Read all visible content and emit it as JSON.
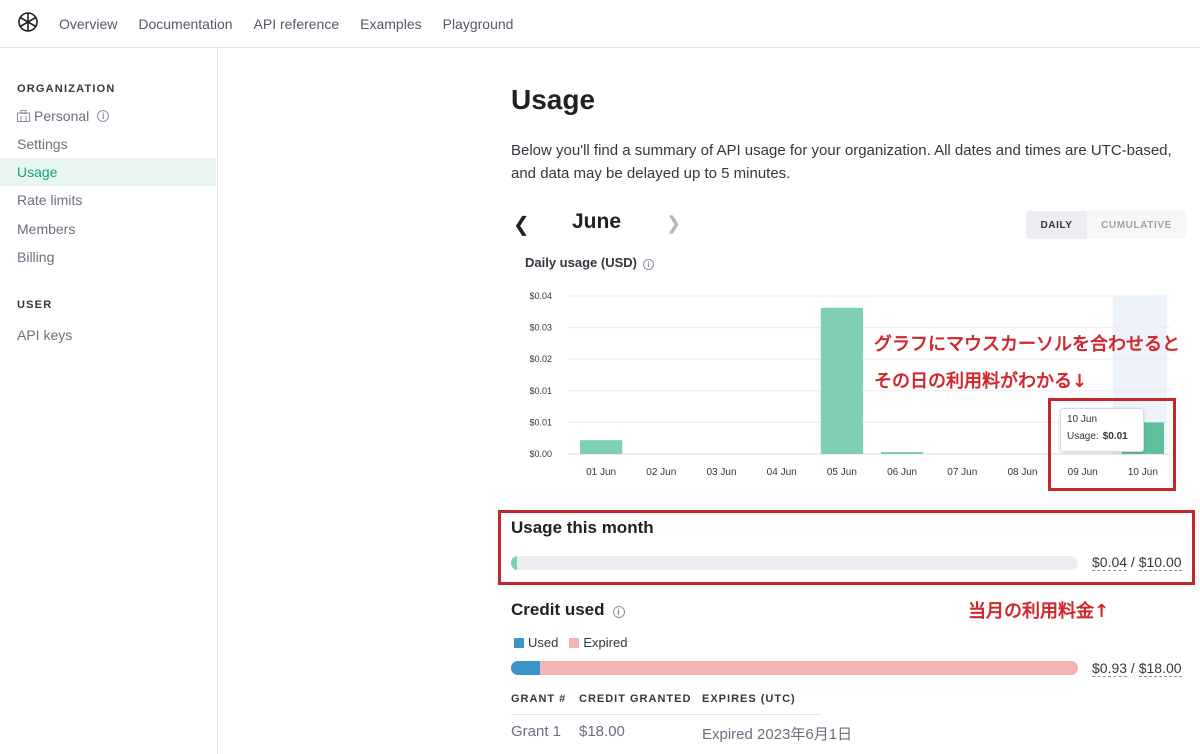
{
  "nav": {
    "links": [
      "Overview",
      "Documentation",
      "API reference",
      "Examples",
      "Playground"
    ]
  },
  "sidebar": {
    "org_heading": "ORGANIZATION",
    "org_name": "Personal",
    "items": [
      "Settings",
      "Usage",
      "Rate limits",
      "Members",
      "Billing"
    ],
    "active_item": "Usage",
    "user_heading": "USER",
    "user_items": [
      "API keys"
    ]
  },
  "page": {
    "title": "Usage",
    "description": "Below you'll find a summary of API usage for your organization. All dates and times are UTC-based, and data may be delayed up to 5 minutes.",
    "month": "June",
    "toggle": [
      "DAILY",
      "CUMULATIVE"
    ],
    "toggle_selected": "DAILY"
  },
  "chart_title": "Daily usage (USD)",
  "chart_data": {
    "type": "bar",
    "title": "Daily usage (USD)",
    "categories": [
      "01 Jun",
      "02 Jun",
      "03 Jun",
      "04 Jun",
      "05 Jun",
      "06 Jun",
      "07 Jun",
      "08 Jun",
      "09 Jun",
      "10 Jun"
    ],
    "values": [
      0.0035,
      0,
      0,
      0,
      0.037,
      0.0005,
      0,
      0,
      0,
      0.008
    ],
    "y_ticks": [
      "$0.00",
      "$0.01",
      "$0.01",
      "$0.02",
      "$0.03",
      "$0.04"
    ],
    "ylim": [
      0,
      0.04
    ],
    "grid": true,
    "bar_color": "#7ecfb5",
    "highlight_color": "#5fbf9d",
    "highlighted_category": "10 Jun"
  },
  "tooltip": {
    "date": "10 Jun",
    "label": "Usage:",
    "value": "$0.01"
  },
  "annotations": {
    "chart_note_line1": "グラフにマウスカーソルを合わせると",
    "chart_note_line2": "その日の利用料がわかる↓",
    "month_note": "当月の利用料金↑"
  },
  "usage_month": {
    "title": "Usage this month",
    "used": "$0.04",
    "limit": "$10.00",
    "fraction": 0.004,
    "color": "#7ecfb5"
  },
  "credit": {
    "title": "Credit used",
    "legend_used": "Used",
    "legend_expired": "Expired",
    "used_color": "#3a95c9",
    "expired_color": "#f2b3b5",
    "used_fraction": 0.052,
    "used": "$0.93",
    "total": "$18.00"
  },
  "grants": {
    "headers": [
      "GRANT #",
      "CREDIT GRANTED",
      "EXPIRES (UTC)"
    ],
    "rows": [
      [
        "Grant 1",
        "$18.00",
        "Expired 2023年6月1日"
      ]
    ]
  }
}
